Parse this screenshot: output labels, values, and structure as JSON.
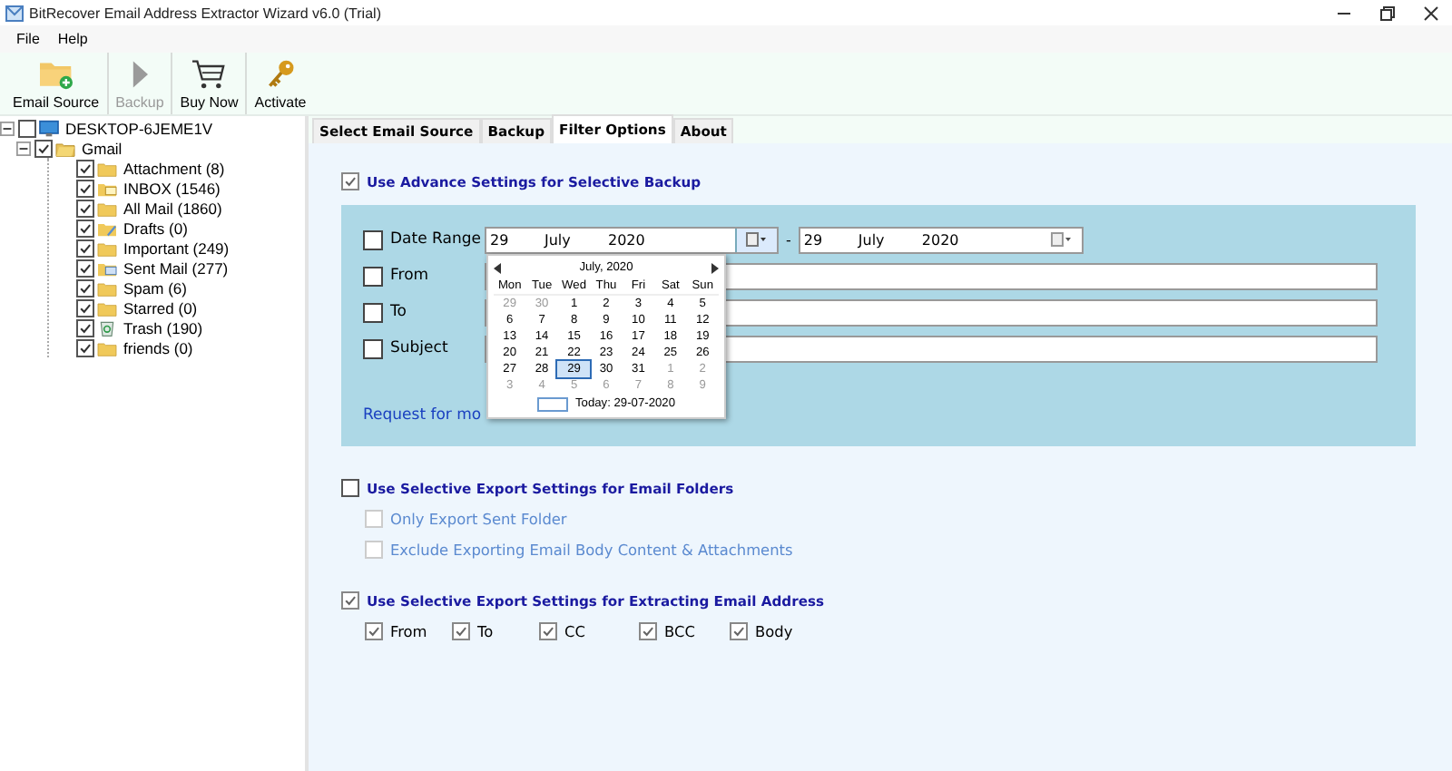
{
  "window": {
    "title": "BitRecover Email Address Extractor Wizard v6.0 (Trial)"
  },
  "menu": [
    "File",
    "Help"
  ],
  "toolbar": [
    {
      "label": "Email Source",
      "kind": "folder",
      "disabled": false
    },
    {
      "label": "Backup",
      "kind": "play",
      "disabled": true
    },
    {
      "label": "Buy Now",
      "kind": "cart",
      "disabled": false
    },
    {
      "label": "Activate",
      "kind": "key",
      "disabled": false
    }
  ],
  "tree": {
    "label": "DESKTOP-6JEME1V",
    "kind": "computer",
    "checked": false,
    "expanded": true,
    "children": [
      {
        "label": "Gmail",
        "kind": "account",
        "checked": true,
        "expanded": true,
        "children": [
          {
            "label": "Attachment (8)",
            "kind": "folder",
            "checked": true
          },
          {
            "label": "INBOX (1546)",
            "kind": "inbox",
            "checked": true
          },
          {
            "label": "All Mail (1860)",
            "kind": "folder",
            "checked": true
          },
          {
            "label": "Drafts (0)",
            "kind": "drafts",
            "checked": true
          },
          {
            "label": "Important (249)",
            "kind": "folder",
            "checked": true
          },
          {
            "label": "Sent Mail (277)",
            "kind": "sent",
            "checked": true
          },
          {
            "label": "Spam (6)",
            "kind": "folder",
            "checked": true
          },
          {
            "label": "Starred (0)",
            "kind": "folder",
            "checked": true
          },
          {
            "label": "Trash (190)",
            "kind": "trash",
            "checked": true
          },
          {
            "label": "friends (0)",
            "kind": "folder",
            "checked": true
          }
        ]
      }
    ]
  },
  "tabs": [
    {
      "label": "Select Email Source",
      "selected": false
    },
    {
      "label": "Backup",
      "selected": false
    },
    {
      "label": "Filter Options",
      "selected": true
    },
    {
      "label": "About",
      "selected": false
    }
  ],
  "advanced": {
    "label": "Use Advance Settings for Selective Backup",
    "checked": true,
    "date_range": {
      "label": "Date Range",
      "checked": false,
      "separator": "-",
      "from": {
        "day": "29",
        "month": "July",
        "year": "2020"
      },
      "to": {
        "day": "29",
        "month": "July",
        "year": "2020"
      }
    },
    "filters": [
      {
        "label": "From",
        "checked": false
      },
      {
        "label": "To",
        "checked": false
      },
      {
        "label": "Subject",
        "checked": false
      }
    ],
    "calendar": {
      "title": "July, 2020",
      "weekdays": [
        "Mon",
        "Tue",
        "Wed",
        "Thu",
        "Fri",
        "Sat",
        "Sun"
      ],
      "weeks": [
        [
          {
            "day": "29",
            "other_month": true,
            "selected": false
          },
          {
            "day": "30",
            "other_month": true,
            "selected": false
          },
          {
            "day": "1",
            "other_month": false,
            "selected": false
          },
          {
            "day": "2",
            "other_month": false,
            "selected": false
          },
          {
            "day": "3",
            "other_month": false,
            "selected": false
          },
          {
            "day": "4",
            "other_month": false,
            "selected": false
          },
          {
            "day": "5",
            "other_month": false,
            "selected": false
          }
        ],
        [
          {
            "day": "6",
            "other_month": false,
            "selected": false
          },
          {
            "day": "7",
            "other_month": false,
            "selected": false
          },
          {
            "day": "8",
            "other_month": false,
            "selected": false
          },
          {
            "day": "9",
            "other_month": false,
            "selected": false
          },
          {
            "day": "10",
            "other_month": false,
            "selected": false
          },
          {
            "day": "11",
            "other_month": false,
            "selected": false
          },
          {
            "day": "12",
            "other_month": false,
            "selected": false
          }
        ],
        [
          {
            "day": "13",
            "other_month": false,
            "selected": false
          },
          {
            "day": "14",
            "other_month": false,
            "selected": false
          },
          {
            "day": "15",
            "other_month": false,
            "selected": false
          },
          {
            "day": "16",
            "other_month": false,
            "selected": false
          },
          {
            "day": "17",
            "other_month": false,
            "selected": false
          },
          {
            "day": "18",
            "other_month": false,
            "selected": false
          },
          {
            "day": "19",
            "other_month": false,
            "selected": false
          }
        ],
        [
          {
            "day": "20",
            "other_month": false,
            "selected": false
          },
          {
            "day": "21",
            "other_month": false,
            "selected": false
          },
          {
            "day": "22",
            "other_month": false,
            "selected": false
          },
          {
            "day": "23",
            "other_month": false,
            "selected": false
          },
          {
            "day": "24",
            "other_month": false,
            "selected": false
          },
          {
            "day": "25",
            "other_month": false,
            "selected": false
          },
          {
            "day": "26",
            "other_month": false,
            "selected": false
          }
        ],
        [
          {
            "day": "27",
            "other_month": false,
            "selected": false
          },
          {
            "day": "28",
            "other_month": false,
            "selected": false
          },
          {
            "day": "29",
            "other_month": false,
            "selected": true
          },
          {
            "day": "30",
            "other_month": false,
            "selected": false
          },
          {
            "day": "31",
            "other_month": false,
            "selected": false
          },
          {
            "day": "1",
            "other_month": true,
            "selected": false
          },
          {
            "day": "2",
            "other_month": true,
            "selected": false
          }
        ],
        [
          {
            "day": "3",
            "other_month": true,
            "selected": false
          },
          {
            "day": "4",
            "other_month": true,
            "selected": false
          },
          {
            "day": "5",
            "other_month": true,
            "selected": false
          },
          {
            "day": "6",
            "other_month": true,
            "selected": false
          },
          {
            "day": "7",
            "other_month": true,
            "selected": false
          },
          {
            "day": "8",
            "other_month": true,
            "selected": false
          },
          {
            "day": "9",
            "other_month": true,
            "selected": false
          }
        ]
      ],
      "today": "Today: 29-07-2020"
    },
    "link": "Request for mo"
  },
  "folder_settings": {
    "label": "Use Selective Export Settings for Email Folders",
    "checked": false,
    "options": [
      {
        "label": "Only Export Sent Folder",
        "checked": false,
        "disabled": true
      },
      {
        "label": "Exclude Exporting Email Body Content & Attachments",
        "checked": false,
        "disabled": true
      }
    ]
  },
  "extract_settings": {
    "label": "Use Selective Export Settings for Extracting Email Address",
    "checked": true,
    "options": [
      {
        "label": "From",
        "checked": true
      },
      {
        "label": "To",
        "checked": true
      },
      {
        "label": "CC",
        "checked": true
      },
      {
        "label": "BCC",
        "checked": true
      },
      {
        "label": "Body",
        "checked": true
      }
    ]
  }
}
